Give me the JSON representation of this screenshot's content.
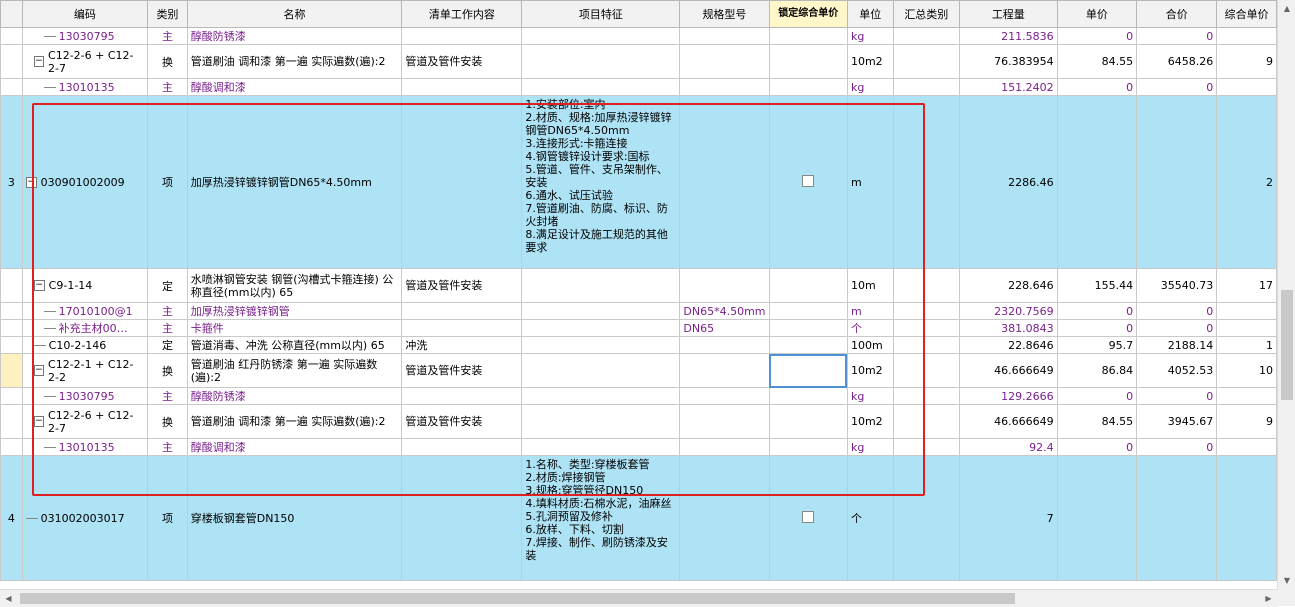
{
  "headers": [
    "",
    "编码",
    "类别",
    "名称",
    "清单工作内容",
    "项目特征",
    "规格型号",
    "锁定综合单价",
    "单位",
    "汇总类别",
    "工程量",
    "单价",
    "合价",
    "综合单价"
  ],
  "rows": [
    {
      "no": "",
      "code": "13030795",
      "type": "主",
      "name": "醇酸防锈漆",
      "work": "",
      "spec": "",
      "lock": "",
      "unit": "kg",
      "qty": "211.5836",
      "price": "0",
      "total": "0",
      "comp": "",
      "style": "material",
      "tree": "line"
    },
    {
      "no": "",
      "code": "C12-2-6 + C12-2-7",
      "type": "换",
      "name": "管道刷油 调和漆 第一遍  实际遍数(遍):2",
      "work": "管道及管件安装",
      "spec": "",
      "lock": "",
      "unit": "10m2",
      "qty": "76.383954",
      "price": "84.55",
      "total": "6458.26",
      "comp": "9",
      "style": "normal",
      "tree": "minus"
    },
    {
      "no": "",
      "code": "13010135",
      "type": "主",
      "name": "醇酸调和漆",
      "work": "",
      "spec": "",
      "lock": "",
      "unit": "kg",
      "qty": "151.2402",
      "price": "0",
      "total": "0",
      "comp": "",
      "style": "material",
      "tree": "line"
    },
    {
      "no": "3",
      "code": "030901002009",
      "type": "项",
      "name": "加厚热浸锌镀锌钢管DN65*4.50mm",
      "work": "",
      "features": "1.安装部位:室内\n2.材质、规格:加厚热浸锌镀锌钢管DN65*4.50mm\n3.连接形式:卡箍连接\n4.钢管镀锌设计要求:国标\n5.管道、管件、支吊架制作、安装\n6.通水、试压试验\n7.管道刷油、防腐、标识、防火封堵\n8.满足设计及施工规范的其他要求",
      "spec": "",
      "lock": "checkbox",
      "unit": "m",
      "qty": "2286.46",
      "price": "",
      "total": "",
      "comp": "2",
      "style": "item",
      "tree": "minus"
    },
    {
      "no": "",
      "code": "C9-1-14",
      "type": "定",
      "name": "水喷淋钢管安装 钢管(沟槽式卡箍连接) 公称直径(mm以内) 65",
      "work": "管道及管件安装",
      "spec": "",
      "lock": "",
      "unit": "10m",
      "qty": "228.646",
      "price": "155.44",
      "total": "35540.73",
      "comp": "17",
      "style": "normal",
      "tree": "minus"
    },
    {
      "no": "",
      "code": "17010100@1",
      "type": "主",
      "name": "加厚热浸锌镀锌钢管",
      "work": "",
      "spec": "DN65*4.50mm",
      "lock": "",
      "unit": "m",
      "qty": "2320.7569",
      "price": "0",
      "total": "0",
      "comp": "",
      "style": "material",
      "tree": "line"
    },
    {
      "no": "",
      "code": "补充主材00…",
      "type": "主",
      "name": "卡箍件",
      "work": "",
      "spec": "DN65",
      "lock": "",
      "unit": "个",
      "qty": "381.0843",
      "price": "0",
      "total": "0",
      "comp": "",
      "style": "material",
      "tree": "line"
    },
    {
      "no": "",
      "code": "C10-2-146",
      "type": "定",
      "name": "管道消毒、冲洗 公称直径(mm以内) 65",
      "work": "冲洗",
      "spec": "",
      "lock": "",
      "unit": "100m",
      "qty": "22.8646",
      "price": "95.7",
      "total": "2188.14",
      "comp": "1",
      "style": "normal",
      "tree": "line"
    },
    {
      "no": "",
      "code": "C12-2-1 + C12-2-2",
      "type": "换",
      "name": "管道刷油 红丹防锈漆 第一遍  实际遍数(遍):2",
      "work": "管道及管件安装",
      "spec": "",
      "lock": "selected",
      "unit": "10m2",
      "qty": "46.666649",
      "price": "86.84",
      "total": "4052.53",
      "comp": "10",
      "style": "normal",
      "tree": "minus"
    },
    {
      "no": "",
      "code": "13030795",
      "type": "主",
      "name": "醇酸防锈漆",
      "work": "",
      "spec": "",
      "lock": "",
      "unit": "kg",
      "qty": "129.2666",
      "price": "0",
      "total": "0",
      "comp": "",
      "style": "material",
      "tree": "line"
    },
    {
      "no": "",
      "code": "C12-2-6 + C12-2-7",
      "type": "换",
      "name": "管道刷油 调和漆 第一遍  实际遍数(遍):2",
      "work": "管道及管件安装",
      "spec": "",
      "lock": "",
      "unit": "10m2",
      "qty": "46.666649",
      "price": "84.55",
      "total": "3945.67",
      "comp": "9",
      "style": "normal",
      "tree": "minus"
    },
    {
      "no": "",
      "code": "13010135",
      "type": "主",
      "name": "醇酸调和漆",
      "work": "",
      "spec": "",
      "lock": "",
      "unit": "kg",
      "qty": "92.4",
      "price": "0",
      "total": "0",
      "comp": "",
      "style": "material",
      "tree": "line"
    },
    {
      "no": "4",
      "code": "031002003017",
      "type": "项",
      "name": "穿楼板钢套管DN150",
      "work": "",
      "features": "1.名称、类型:穿楼板套管\n2.材质:焊接钢管\n3.规格:穿管管径DN150\n4.填料材质:石棉水泥，油麻丝\n5.孔洞预留及修补\n6.放样、下料、切割\n7.焊接、制作、刷防锈漆及安装",
      "spec": "",
      "lock": "checkbox",
      "unit": "个",
      "qty": "7",
      "price": "",
      "total": "",
      "comp": "",
      "style": "item",
      "tree": "line"
    }
  ]
}
